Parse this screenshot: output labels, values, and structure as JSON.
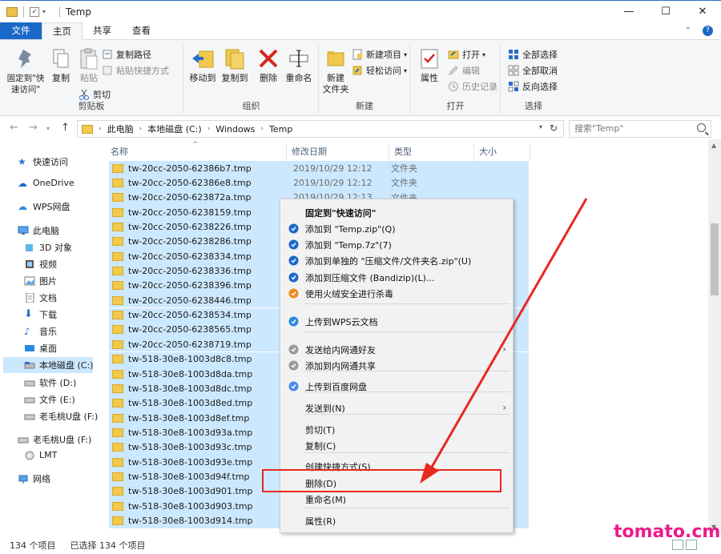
{
  "window": {
    "title": "Temp",
    "minimize": "—",
    "maximize": "☐",
    "close": "✕"
  },
  "ribbon_tabs": [
    "文件",
    "主页",
    "共享",
    "查看"
  ],
  "ribbon": {
    "clipboard": {
      "label": "剪贴板",
      "pin": "固定到\"快速访问\"",
      "copy": "复制",
      "paste": "粘贴",
      "copy_path": "复制路径",
      "paste_shortcut": "粘贴快捷方式",
      "cut": "剪切"
    },
    "organize": {
      "label": "组织",
      "move_to": "移动到",
      "copy_to": "复制到",
      "delete": "删除",
      "rename": "重命名"
    },
    "new": {
      "label": "新建",
      "new_folder": "新建\n文件夹",
      "new_item": "新建项目",
      "easy_access": "轻松访问"
    },
    "open": {
      "label": "打开",
      "properties": "属性",
      "open": "打开",
      "edit": "编辑",
      "history": "历史记录"
    },
    "select": {
      "label": "选择",
      "select_all": "全部选择",
      "select_none": "全部取消",
      "invert": "反向选择"
    }
  },
  "address": {
    "crumbs": [
      "此电脑",
      "本地磁盘 (C:)",
      "Windows",
      "Temp"
    ],
    "search_placeholder": "搜索\"Temp\""
  },
  "nav": {
    "quick_access": "快速访问",
    "onedrive": "OneDrive",
    "wps": "WPS网盘",
    "this_pc": "此电脑",
    "children": [
      "3D 对象",
      "视频",
      "图片",
      "文档",
      "下载",
      "音乐",
      "桌面",
      "本地磁盘 (C:)",
      "软件 (D:)",
      "文件 (E:)",
      "老毛桃U盘 (F:)"
    ],
    "usb": "老毛桃U盘 (F:)",
    "lmt": "LMT",
    "network": "网络"
  },
  "columns": {
    "name": "名称",
    "date": "修改日期",
    "type": "类型",
    "size": "大小"
  },
  "files": [
    {
      "name": "tw-20cc-2050-62386b7.tmp",
      "date": "2019/10/29 12:12",
      "type": "文件夹"
    },
    {
      "name": "tw-20cc-2050-62386e8.tmp",
      "date": "2019/10/29 12:12",
      "type": "文件夹"
    },
    {
      "name": "tw-20cc-2050-623872a.tmp",
      "date": "2019/10/29 12:13",
      "type": "文件夹"
    },
    {
      "name": "tw-20cc-2050-6238159.tmp",
      "date": "",
      "type": ""
    },
    {
      "name": "tw-20cc-2050-6238226.tmp",
      "date": "",
      "type": ""
    },
    {
      "name": "tw-20cc-2050-6238286.tmp",
      "date": "",
      "type": ""
    },
    {
      "name": "tw-20cc-2050-6238334.tmp",
      "date": "",
      "type": ""
    },
    {
      "name": "tw-20cc-2050-6238336.tmp",
      "date": "",
      "type": ""
    },
    {
      "name": "tw-20cc-2050-6238396.tmp",
      "date": "",
      "type": ""
    },
    {
      "name": "tw-20cc-2050-6238446.tmp",
      "date": "",
      "type": ""
    },
    {
      "name": "tw-20cc-2050-6238534.tmp",
      "date": "",
      "type": ""
    },
    {
      "name": "tw-20cc-2050-6238565.tmp",
      "date": "",
      "type": ""
    },
    {
      "name": "tw-20cc-2050-6238719.tmp",
      "date": "",
      "type": ""
    },
    {
      "name": "tw-518-30e8-1003d8c8.tmp",
      "date": "",
      "type": ""
    },
    {
      "name": "tw-518-30e8-1003d8da.tmp",
      "date": "",
      "type": ""
    },
    {
      "name": "tw-518-30e8-1003d8dc.tmp",
      "date": "",
      "type": ""
    },
    {
      "name": "tw-518-30e8-1003d8ed.tmp",
      "date": "",
      "type": ""
    },
    {
      "name": "tw-518-30e8-1003d8ef.tmp",
      "date": "",
      "type": ""
    },
    {
      "name": "tw-518-30e8-1003d93a.tmp",
      "date": "",
      "type": ""
    },
    {
      "name": "tw-518-30e8-1003d93c.tmp",
      "date": "",
      "type": ""
    },
    {
      "name": "tw-518-30e8-1003d93e.tmp",
      "date": "",
      "type": ""
    },
    {
      "name": "tw-518-30e8-1003d94f.tmp",
      "date": "",
      "type": ""
    },
    {
      "name": "tw-518-30e8-1003d901.tmp",
      "date": "",
      "type": ""
    },
    {
      "name": "tw-518-30e8-1003d903.tmp",
      "date": "",
      "type": ""
    },
    {
      "name": "tw-518-30e8-1003d914.tmp",
      "date": "",
      "type": ""
    }
  ],
  "context_menu": [
    {
      "label": "固定到\"快速访问\"",
      "bold": true
    },
    {
      "label": "添加到 \"Temp.zip\"(Q)",
      "icon": "bandizip-icon"
    },
    {
      "label": "添加到 \"Temp.7z\"(7)",
      "icon": "bandizip-icon"
    },
    {
      "label": "添加到单独的 \"压缩文件/文件夹名.zip\"(U)",
      "icon": "bandizip-icon"
    },
    {
      "label": "添加到压缩文件 (Bandizip)(L)...",
      "icon": "bandizip-icon"
    },
    {
      "label": "使用火绒安全进行杀毒",
      "icon": "huorong-icon"
    },
    {
      "label": "上传到WPS云文档",
      "icon": "wps-cloud-icon"
    },
    {
      "label": "发送给内网通好友",
      "icon": "neiwangtong-icon",
      "submenu": true
    },
    {
      "label": "添加到内网通共享",
      "icon": "neiwangtong-icon"
    },
    {
      "label": "上传到百度网盘",
      "icon": "baidu-icon"
    },
    {
      "label": "发送到(N)",
      "submenu": true
    },
    {
      "label": "剪切(T)"
    },
    {
      "label": "复制(C)"
    },
    {
      "label": "创建快捷方式(S)"
    },
    {
      "label": "删除(D)"
    },
    {
      "label": "重命名(M)"
    },
    {
      "label": "属性(R)"
    }
  ],
  "status": {
    "item_count": "134 个项目",
    "selected": "已选择 134 个项目"
  },
  "watermark": "tomato.cm",
  "colors": {
    "accent": "#1a69c9",
    "selection": "#cce8ff",
    "highlight": "#e8281f",
    "watermark": "#ea1c8c"
  }
}
